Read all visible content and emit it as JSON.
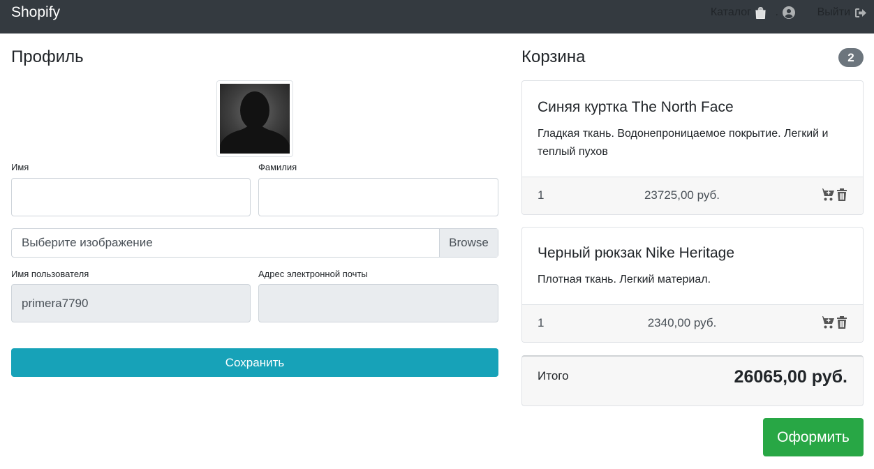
{
  "navbar": {
    "brand": "Shopify",
    "catalog_label": "Каталог",
    "user_label": ".",
    "logout_label": "Выйти"
  },
  "profile": {
    "title": "Профиль",
    "first_name_label": "Имя",
    "first_name_value": "",
    "last_name_label": "Фамилия",
    "last_name_value": "",
    "file_placeholder": "Выберите изображение",
    "browse_label": "Browse",
    "username_label": "Имя пользователя",
    "username_value": "primera7790",
    "email_label": "Адрес электронной почты",
    "email_value": "",
    "save_label": "Сохранить"
  },
  "cart": {
    "title": "Корзина",
    "count": "2",
    "items": [
      {
        "name": "Синяя куртка The North Face",
        "description": "Гладкая ткань. Водонепроницаемое покрытие. Легкий и теплый пухов",
        "quantity": "1",
        "price": "23725,00 руб."
      },
      {
        "name": "Черный рюкзак Nike Heritage",
        "description": "Плотная ткань. Легкий материал.",
        "quantity": "1",
        "price": "2340,00 руб."
      }
    ],
    "total_label": "Итого",
    "total_value": "26065,00 руб.",
    "checkout_label": "Оформить"
  },
  "colors": {
    "navbar": "#343a40",
    "save_button": "#17a2b8",
    "checkout_button": "#28a745",
    "badge": "#6c757d"
  },
  "icons": [
    "shopping-bag-icon",
    "user-circle-icon",
    "sign-out-icon",
    "cart-plus-icon",
    "trash-icon"
  ]
}
